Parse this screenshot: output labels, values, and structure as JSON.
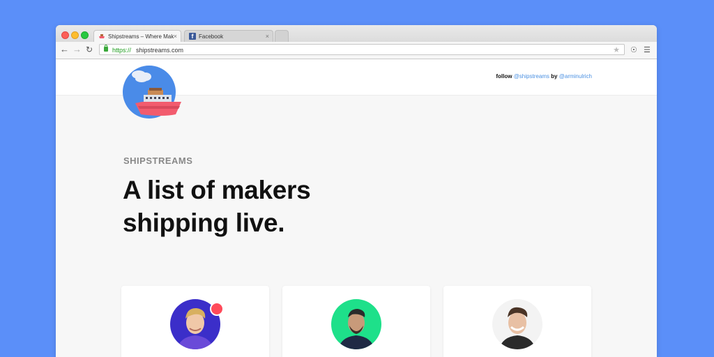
{
  "browser": {
    "tabs": [
      {
        "title": "Shipstreams – Where Mak",
        "active": true
      },
      {
        "title": "Facebook",
        "active": false
      }
    ],
    "url_scheme": "https://",
    "url_host": "shipstreams.com",
    "close_glyph": "×"
  },
  "header": {
    "follow_prefix": "follow",
    "follow_handle": "@shipstreams",
    "by_text": "by",
    "author_handle": "@arminulrich"
  },
  "hero": {
    "eyebrow": "SHIPSTREAMS",
    "headline_line1": "A list of makers",
    "headline_line2": "shipping live."
  },
  "makers": [
    {
      "avatar_bg": "#3b2ec9",
      "live": true
    },
    {
      "avatar_bg": "#1ee08a",
      "live": false
    },
    {
      "avatar_bg": "#f3f3f3",
      "live": false
    }
  ],
  "colors": {
    "background": "#5b8ff9",
    "link": "#4a90e2",
    "live": "#ff4a5a",
    "ship_hull": "#f25c6e"
  }
}
